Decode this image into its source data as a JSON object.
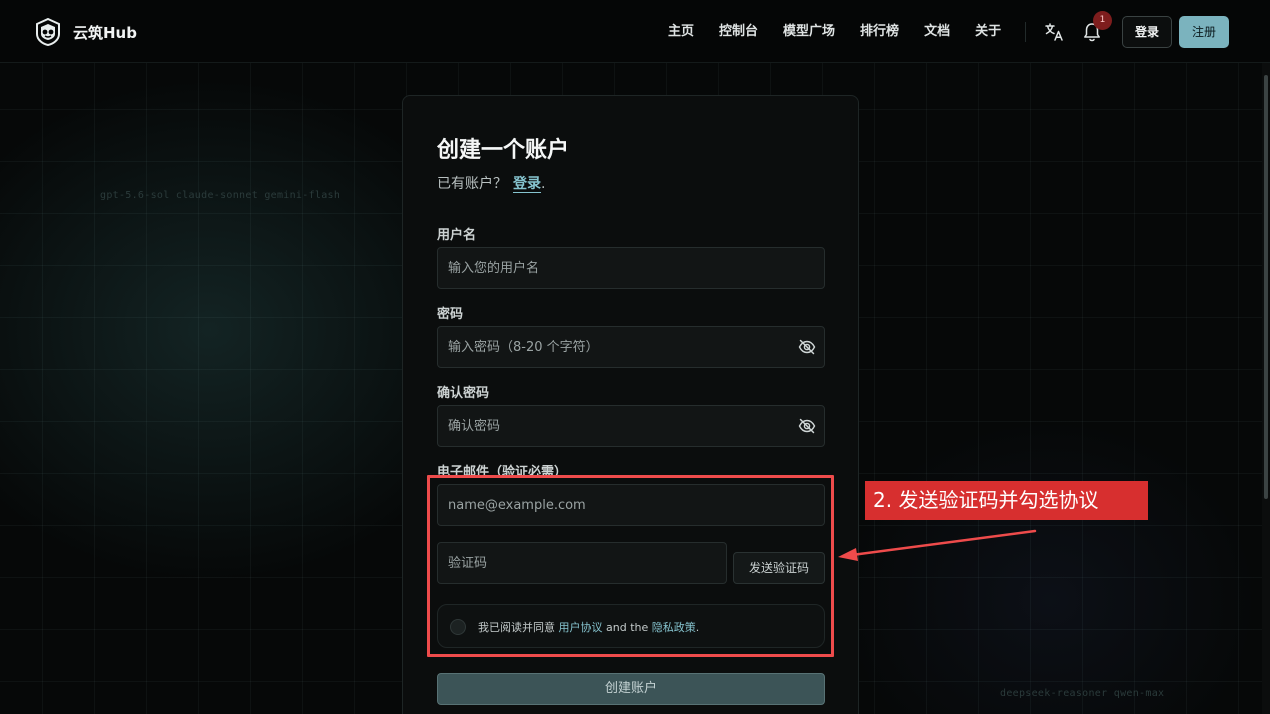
{
  "brand": {
    "name": "云筑Hub"
  },
  "nav": {
    "items": [
      {
        "label": "主页"
      },
      {
        "label": "控制台"
      },
      {
        "label": "模型广场"
      },
      {
        "label": "排行榜"
      },
      {
        "label": "文档"
      },
      {
        "label": "关于"
      }
    ],
    "notification_count": "1",
    "login_label": "登录",
    "register_label": "注册"
  },
  "background": {
    "floating_text_1": "gpt-5.6-sol claude-sonnet gemini-flash",
    "floating_text_2": "deepseek-reasoner qwen-max"
  },
  "form": {
    "title": "创建一个账户",
    "subtitle_prefix": "已有账户？",
    "subtitle_link": "登录",
    "subtitle_suffix": ".",
    "username_label": "用户名",
    "username_placeholder": "输入您的用户名",
    "password_label": "密码",
    "password_placeholder": "输入密码（8-20 个字符）",
    "confirm_label": "确认密码",
    "confirm_placeholder": "确认密码",
    "email_label": "电子邮件（验证必需）",
    "email_placeholder": "name@example.com",
    "code_placeholder": "验证码",
    "send_code_label": "发送验证码",
    "agree_prefix": "我已阅读并同意 ",
    "agree_terms": "用户协议",
    "agree_middle": " and the ",
    "agree_privacy": "隐私政策",
    "agree_suffix": ".",
    "submit_label": "创建账户"
  },
  "annotation": {
    "callout_text": "2. 发送验证码并勾选协议",
    "color": "#d72f2f"
  },
  "colors": {
    "accent": "#7bb3be",
    "link": "#86c4cf",
    "background": "#060808"
  },
  "icons": {
    "translate": "translate-icon",
    "notification": "bell-icon",
    "password_toggle": "eye-off-icon"
  }
}
